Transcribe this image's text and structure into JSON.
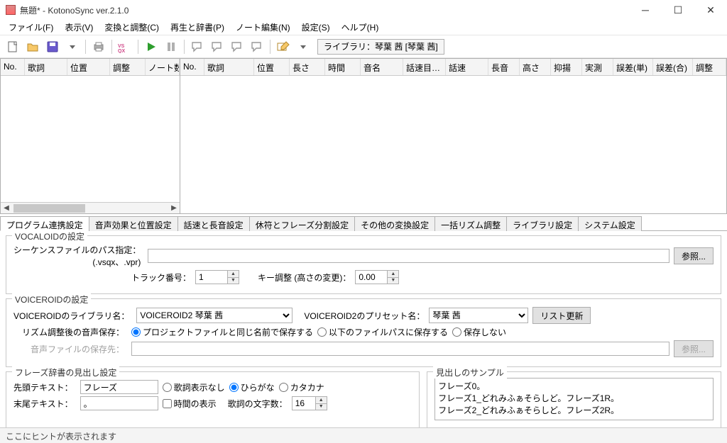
{
  "title": "無題* - KotonoSync ver.2.1.0",
  "menu": [
    "ファイル(F)",
    "表示(V)",
    "変換と調整(C)",
    "再生と辞書(P)",
    "ノート編集(N)",
    "設定(S)",
    "ヘルプ(H)"
  ],
  "library_label": "ライブラリ：琴葉 茜 [琴葉 茜]",
  "left_cols": [
    "No.",
    "歌詞",
    "位置",
    "調整",
    "ノート数"
  ],
  "right_cols": [
    "No.",
    "歌詞",
    "位置",
    "長さ",
    "時間",
    "音名",
    "話速目…",
    "話速",
    "長音",
    "高さ",
    "抑揚",
    "実測",
    "誤差(単)",
    "誤差(合)",
    "調整"
  ],
  "tabs": [
    "プログラム連携設定",
    "音声効果と位置設定",
    "話速と長音設定",
    "休符とフレーズ分割設定",
    "その他の変換設定",
    "一括リズム調整",
    "ライブラリ設定",
    "システム設定"
  ],
  "vocaloid": {
    "legend": "VOCALOIDの設定",
    "path_label": "シーケンスファイルのパス指定：\n(.vsqx、.vpr)",
    "browse": "参照...",
    "track_label": "トラック番号：",
    "track_value": "1",
    "key_label": "キー調整 (高さの変更)：",
    "key_value": "0.00"
  },
  "voiceroid": {
    "legend": "VOICEROIDの設定",
    "lib_label": "VOICEROIDのライブラリ名：",
    "lib_value": "VOICEROID2 琴葉 茜",
    "preset_label": "VOICEROID2のプリセット名：",
    "preset_value": "琴葉 茜",
    "update_btn": "リスト更新",
    "save_label": "リズム調整後の音声保存：",
    "save_opts": [
      "プロジェクトファイルと同じ名前で保存する",
      "以下のファイルパスに保存する",
      "保存しない"
    ],
    "save_path_label": "音声ファイルの保存先：",
    "browse": "参照..."
  },
  "phrase": {
    "legend": "フレーズ辞書の見出し設定",
    "head_label": "先頭テキスト：",
    "head_value": "フレーズ",
    "tail_label": "末尾テキスト：",
    "tail_value": "。",
    "opts": [
      "歌詞表示なし",
      "ひらがな",
      "カタカナ"
    ],
    "time_check": "時間の表示",
    "count_label": "歌詞の文字数：",
    "count_value": "16"
  },
  "sample": {
    "legend": "見出しのサンプル",
    "text": "フレーズ0。\nフレーズ1_どれみふぁそらしど。フレーズ1R。\nフレーズ2_どれみふぁそらしど。フレーズ2R。"
  },
  "status": "ここにヒントが表示されます"
}
